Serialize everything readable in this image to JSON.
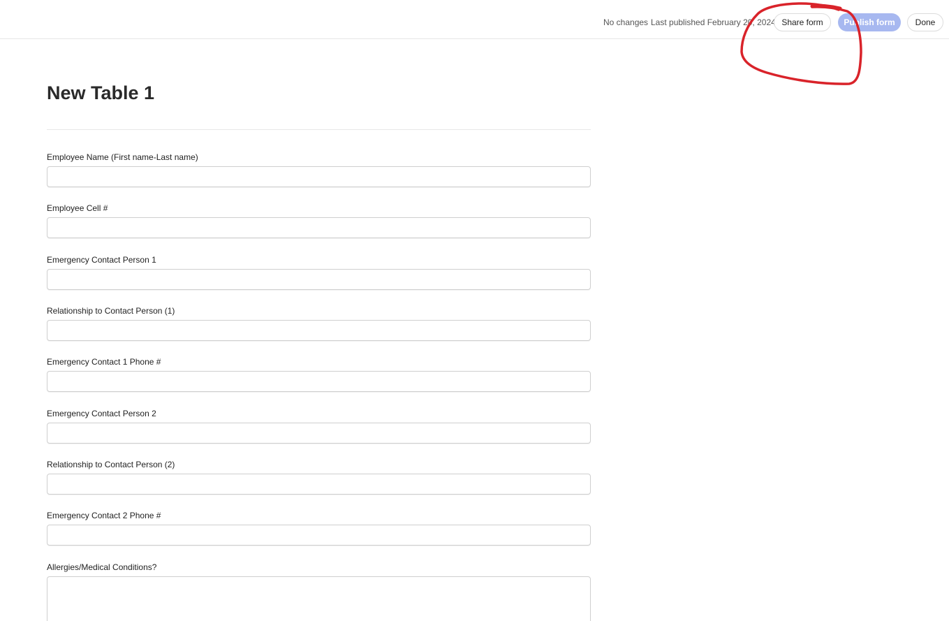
{
  "header": {
    "status": "No changes",
    "last_published": "Last published February 20, 2024",
    "share_label": "Share form",
    "publish_label": "Publish form",
    "done_label": "Done",
    "publish_color": "#a7b8f0",
    "annotation_color": "#d9232a"
  },
  "form": {
    "title": "New Table 1",
    "fields": [
      {
        "label": "Employee Name (First name-Last name)",
        "value": ""
      },
      {
        "label": "Employee Cell #",
        "value": ""
      },
      {
        "label": "Emergency Contact Person 1",
        "value": ""
      },
      {
        "label": "Relationship to Contact Person (1)",
        "value": ""
      },
      {
        "label": "Emergency Contact 1 Phone #",
        "value": ""
      },
      {
        "label": "Emergency Contact Person 2",
        "value": ""
      },
      {
        "label": "Relationship to Contact Person (2)",
        "value": ""
      },
      {
        "label": "Emergency Contact 2 Phone #",
        "value": ""
      },
      {
        "label": "Allergies/Medical Conditions?",
        "value": ""
      }
    ]
  }
}
